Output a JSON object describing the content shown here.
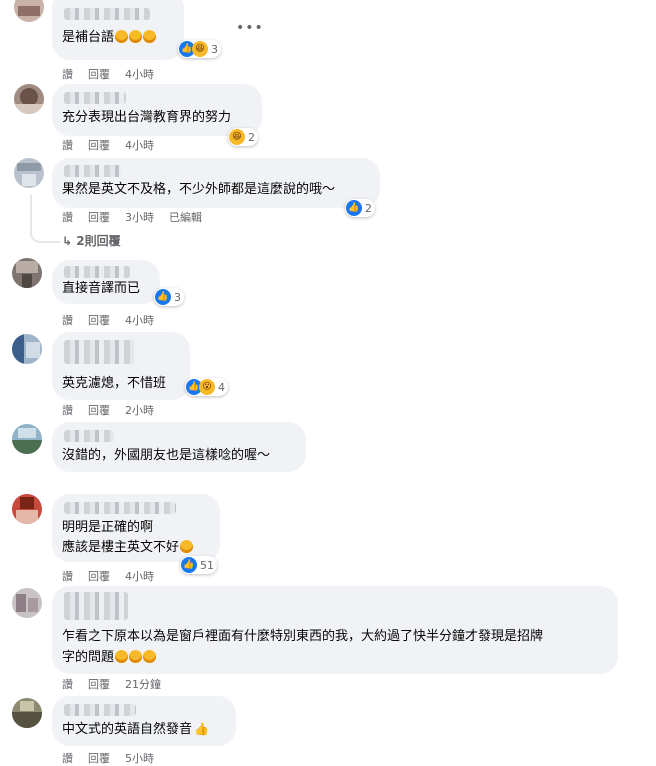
{
  "actions": {
    "like": "讚",
    "reply": "回覆",
    "edited": "已編輯"
  },
  "comments": [
    {
      "text": [
        "是補台語"
      ],
      "time": "4小時",
      "reactions": "3"
    },
    {
      "text": [
        "充分表現出台灣教育界的努力"
      ],
      "time": "4小時",
      "reactions": "2"
    },
    {
      "text": [
        "果然是英文不及格，不少外師都是這麼說的哦～"
      ],
      "time": "3小時",
      "reactions": "2"
    },
    {
      "text": [
        "直接音譯而已"
      ],
      "time": "4小時",
      "reactions": "3"
    },
    {
      "text": [
        "英克濾熄，不惜班"
      ],
      "time": "2小時",
      "reactions": "4"
    },
    {
      "text": [
        "沒錯的，外國朋友也是這樣唸的喔～"
      ],
      "time": "",
      "reactions": ""
    },
    {
      "text": [
        "明明是正確的啊",
        "應該是樓主英文不好"
      ],
      "time": "4小時",
      "reactions": "51"
    },
    {
      "text": [
        "乍看之下原本以為是窗戶裡面有什麼特別東西的我，大約過了快半分鐘才發現是招牌",
        "字的問題"
      ],
      "time": "21分鐘",
      "reactions": ""
    },
    {
      "text": [
        "中文式的英語自然發音"
      ],
      "time": "5小時",
      "reactions": ""
    }
  ],
  "replies_link": "2則回覆",
  "more_options_icon": "more-horizontal-icon",
  "colors": {
    "bubble": "#f0f2f5",
    "like_blue": "#1877f2",
    "haha_yellow": "#f7b928",
    "meta_gray": "#65676b"
  }
}
